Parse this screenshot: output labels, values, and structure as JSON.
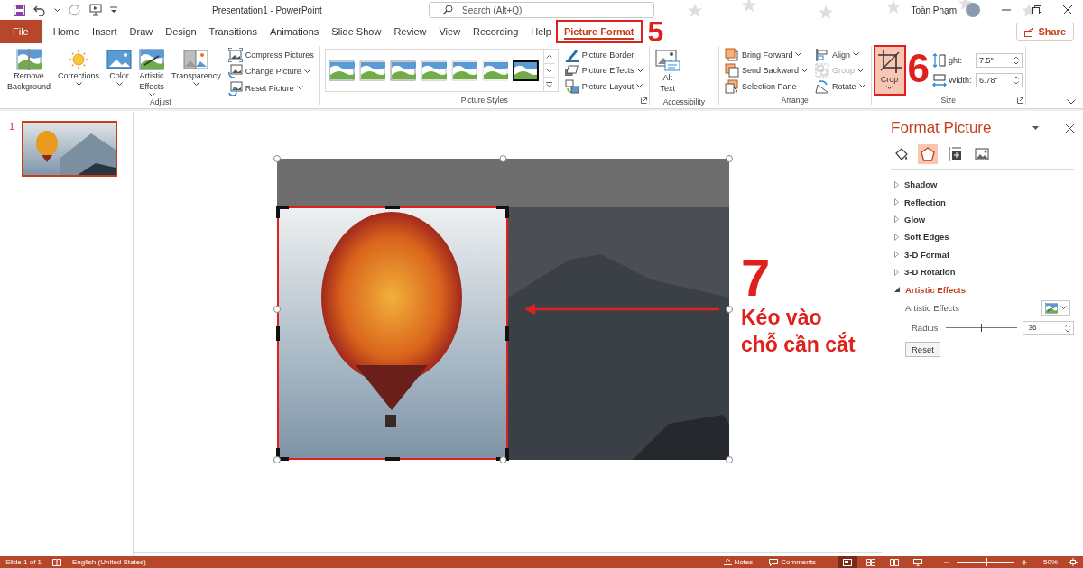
{
  "title_bar": {
    "title": "Presentation1  -  PowerPoint",
    "search": {
      "placeholder": "Search (Alt+Q)"
    },
    "user": "Toàn Phạm"
  },
  "tabs": [
    {
      "label": "File",
      "kind": "file",
      "selected": false
    },
    {
      "label": "Home",
      "kind": "tab",
      "selected": false
    },
    {
      "label": "Insert",
      "kind": "tab",
      "selected": false
    },
    {
      "label": "Draw",
      "kind": "tab",
      "selected": false
    },
    {
      "label": "Design",
      "kind": "tab",
      "selected": false
    },
    {
      "label": "Transitions",
      "kind": "tab",
      "selected": false
    },
    {
      "label": "Animations",
      "kind": "tab",
      "selected": false
    },
    {
      "label": "Slide Show",
      "kind": "tab",
      "selected": false
    },
    {
      "label": "Review",
      "kind": "tab",
      "selected": false
    },
    {
      "label": "View",
      "kind": "tab",
      "selected": false
    },
    {
      "label": "Recording",
      "kind": "tab",
      "selected": false
    },
    {
      "label": "Help",
      "kind": "tab",
      "selected": false
    },
    {
      "label": "Picture Format",
      "kind": "tab",
      "selected": true
    }
  ],
  "tab_callout": "5",
  "share_button": "Share",
  "ribbon": {
    "groups": [
      {
        "label": "Adjust",
        "launcher": false,
        "items": [
          {
            "kind": "large",
            "lines": [
              "Remove",
              "Background"
            ],
            "dropdown": false,
            "highlighted": false
          },
          {
            "kind": "large",
            "lines": [
              "Corrections"
            ],
            "dropdown": true,
            "highlighted": false
          },
          {
            "kind": "large",
            "lines": [
              "Color"
            ],
            "dropdown": true,
            "highlighted": false
          },
          {
            "kind": "large",
            "lines": [
              "Artistic",
              "Effects"
            ],
            "dropdown": true,
            "highlighted": false
          },
          {
            "kind": "large",
            "lines": [
              "Transparency"
            ],
            "dropdown": true,
            "highlighted": false
          },
          {
            "kind": "stack",
            "items": [
              {
                "label": "Compress Pictures",
                "dropdown": false,
                "disabled": false
              },
              {
                "label": "Change Picture",
                "dropdown": true,
                "disabled": false
              },
              {
                "label": "Reset Picture",
                "dropdown": true,
                "disabled": false
              }
            ]
          }
        ]
      },
      {
        "label": "Picture Styles",
        "launcher": true,
        "items": [
          {
            "kind": "gallery"
          },
          {
            "kind": "stack",
            "items": [
              {
                "label": "Picture Border",
                "dropdown": false,
                "disabled": false
              },
              {
                "label": "Picture Effects",
                "dropdown": true,
                "disabled": false
              },
              {
                "label": "Picture Layout",
                "dropdown": true,
                "disabled": false
              }
            ]
          }
        ]
      },
      {
        "label": "Accessibility",
        "launcher": false,
        "items": [
          {
            "kind": "large",
            "lines": [
              "Alt",
              "Text"
            ],
            "dropdown": false,
            "highlighted": false
          }
        ]
      },
      {
        "label": "Arrange",
        "launcher": false,
        "items": [
          {
            "kind": "stack",
            "items": [
              {
                "label": "Bring Forward",
                "dropdown": true,
                "disabled": false
              },
              {
                "label": "Send Backward",
                "dropdown": true,
                "disabled": false
              },
              {
                "label": "Selection Pane",
                "dropdown": false,
                "disabled": false
              }
            ]
          },
          {
            "kind": "stack",
            "items": [
              {
                "label": "Align",
                "dropdown": true,
                "disabled": false
              },
              {
                "label": "Group",
                "dropdown": true,
                "disabled": true
              },
              {
                "label": "Rotate",
                "dropdown": true,
                "disabled": false
              }
            ]
          }
        ]
      },
      {
        "label": "Size",
        "launcher": true,
        "items": [
          {
            "kind": "large",
            "lines": [
              "Crop"
            ],
            "dropdown": true,
            "highlighted": true
          },
          {
            "kind": "callout",
            "text": "6"
          },
          {
            "kind": "fields",
            "items": [
              {
                "label": "ght:",
                "value": "7.5\""
              },
              {
                "label": "Width:",
                "value": "6.78\""
              }
            ]
          }
        ]
      }
    ]
  },
  "thumbnails": [
    {
      "number": "1",
      "selected": true
    }
  ],
  "slide": {
    "callout": {
      "number": "7",
      "lines": [
        "Kéo vào",
        "chỗ cần cắt"
      ]
    }
  },
  "format_pane": {
    "title": "Format Picture",
    "tabs": [
      {
        "selected": false
      },
      {
        "selected": true
      },
      {
        "selected": false
      },
      {
        "selected": false
      }
    ],
    "sections": [
      {
        "label": "Shadow",
        "expanded": false
      },
      {
        "label": "Reflection",
        "expanded": false
      },
      {
        "label": "Glow",
        "expanded": false
      },
      {
        "label": "Soft Edges",
        "expanded": false
      },
      {
        "label": "3-D Format",
        "expanded": false
      },
      {
        "label": "3-D Rotation",
        "expanded": false
      },
      {
        "label": "Artistic Effects",
        "expanded": true,
        "rows": [
          {
            "kind": "preset",
            "label": "Artistic Effects"
          },
          {
            "kind": "slider",
            "label": "Radius",
            "level": 0.5,
            "value": "36"
          },
          {
            "kind": "button",
            "label": "Reset"
          }
        ]
      }
    ]
  },
  "status_bar": {
    "slide": "Slide 1 of 1",
    "language": "English (United States)",
    "notes": "Notes",
    "comments": "Comments",
    "views": [
      {
        "selected": true
      },
      {
        "selected": false
      },
      {
        "selected": false
      },
      {
        "selected": false
      }
    ],
    "zoom": {
      "level": 0.5,
      "reading": "50%"
    }
  }
}
